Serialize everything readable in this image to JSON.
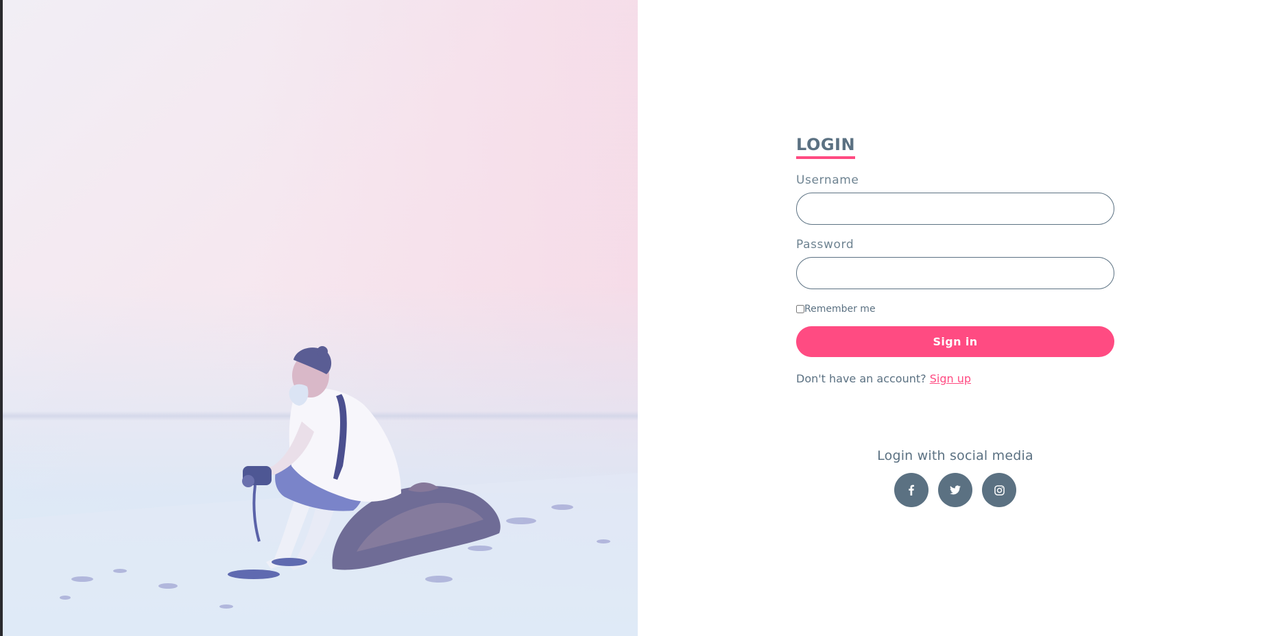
{
  "login": {
    "title": "LOGIN",
    "username_label": "Username",
    "username_value": "",
    "password_label": "Password",
    "password_value": "",
    "remember_label": "Remember me",
    "remember_checked": false,
    "signin_label": "Sign in",
    "signup_prompt": "Don't have an account?",
    "signup_link": "Sign up"
  },
  "social": {
    "title": "Login with social media",
    "icons": [
      "facebook-icon",
      "twitter-icon",
      "instagram-icon"
    ]
  },
  "colors": {
    "accent": "#ff4b82",
    "text": "#5b7182",
    "label": "#6e8391",
    "background": "#ffffff"
  }
}
